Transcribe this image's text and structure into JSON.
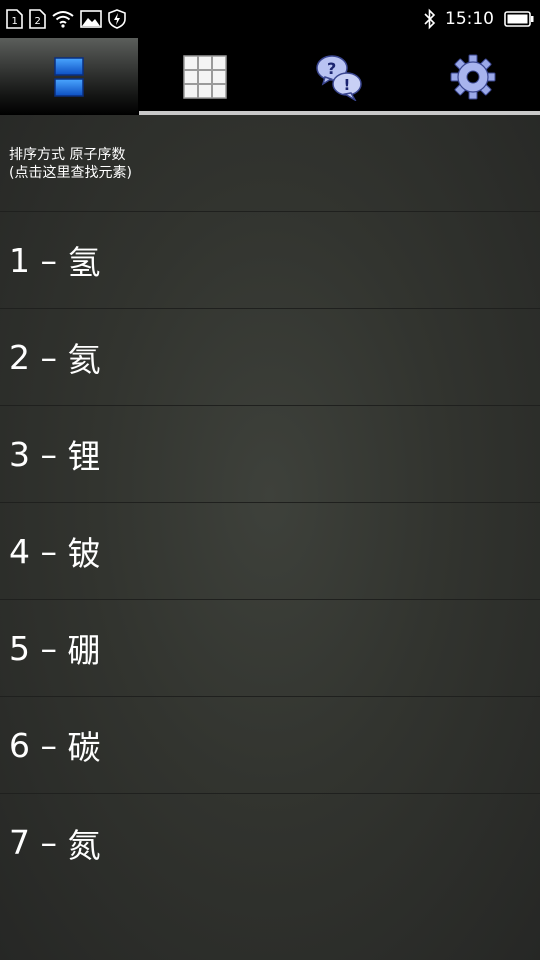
{
  "status_bar": {
    "sim1": "1",
    "sim2": "2",
    "time": "15:10"
  },
  "tabs": [
    {
      "id": "list",
      "icon": "list-view-icon",
      "active": true
    },
    {
      "id": "grid",
      "icon": "grid-view-icon",
      "active": false
    },
    {
      "id": "quiz",
      "icon": "quiz-bubbles-icon",
      "active": false
    },
    {
      "id": "settings",
      "icon": "gear-icon",
      "active": false
    }
  ],
  "sort_header": {
    "line1": "排序方式 原子序数",
    "line2": "(点击这里查找元素)"
  },
  "separator": "–",
  "elements": [
    {
      "number": "1",
      "name": "氢"
    },
    {
      "number": "2",
      "name": "氦"
    },
    {
      "number": "3",
      "name": "锂"
    },
    {
      "number": "4",
      "name": "铍"
    },
    {
      "number": "5",
      "name": "硼"
    },
    {
      "number": "6",
      "name": "碳"
    },
    {
      "number": "7",
      "name": "氮"
    }
  ],
  "colors": {
    "list_icon_blue": "#1a6fe0",
    "gear_blue": "#9aa8e8",
    "tab_underline": "#c8c8c8"
  }
}
